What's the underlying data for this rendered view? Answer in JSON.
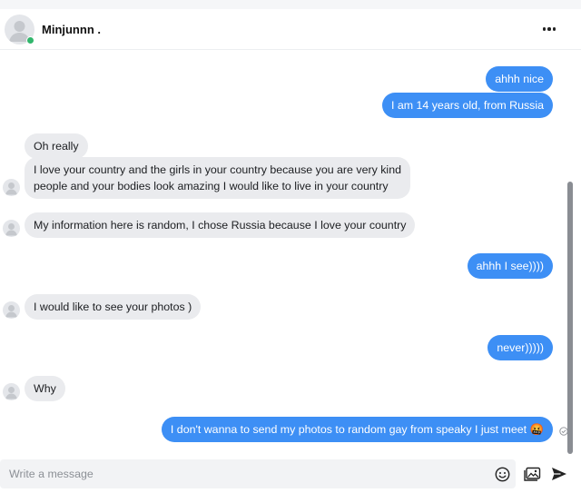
{
  "header": {
    "contact_name": "Minjunnn .",
    "online": true,
    "more_icon": "more-horizontal-icon"
  },
  "messages": [
    {
      "id": "m1",
      "direction": "outgoing",
      "text": "ahhh nice"
    },
    {
      "id": "m2",
      "direction": "outgoing",
      "text": "I am 14 years old, from Russia"
    },
    {
      "id": "m3",
      "direction": "incoming",
      "text": "Oh really"
    },
    {
      "id": "m4",
      "direction": "incoming",
      "lines": [
        "I love your country and the girls in your country because you are very kind",
        "people and your bodies look amazing I would like to live in your country"
      ]
    },
    {
      "id": "m5",
      "direction": "incoming",
      "text": "My information here is random, I chose Russia because I love your country"
    },
    {
      "id": "m6",
      "direction": "outgoing",
      "text": "ahhh I see))))"
    },
    {
      "id": "m7",
      "direction": "incoming",
      "text": "I would like to see your photos )"
    },
    {
      "id": "m8",
      "direction": "outgoing",
      "text": "never)))))"
    },
    {
      "id": "m9",
      "direction": "incoming",
      "text": "Why"
    },
    {
      "id": "m10",
      "direction": "outgoing",
      "text": "I don't wanna to send my photos to random gay from speaky I just meet",
      "emoji": "🤬",
      "seen": true
    }
  ],
  "composer": {
    "placeholder": "Write a message",
    "value": "",
    "emoji_icon": "smiley-icon",
    "image_icon": "image-icon",
    "send_icon": "send-icon"
  },
  "colors": {
    "outgoing_bubble": "#3d8ff5",
    "incoming_bubble": "#eaebee",
    "online_dot": "#31b66c"
  }
}
